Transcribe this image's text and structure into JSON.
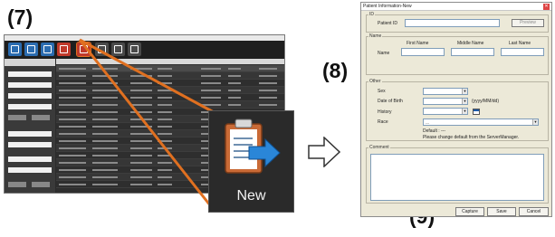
{
  "steps": {
    "seven": "(7)",
    "eight": "(8)",
    "nine": "(9)"
  },
  "toolbar": {
    "buttons": [
      {
        "icon": "list-icon",
        "color": "#2b6cb0"
      },
      {
        "icon": "edit-icon",
        "color": "#2b6cb0"
      },
      {
        "icon": "import-icon",
        "color": "#2b6cb0"
      },
      {
        "icon": "delete-icon",
        "color": "#c0392b"
      },
      {
        "icon": "new-patient-icon",
        "color": "#c0392b"
      },
      {
        "icon": "search-icon",
        "color": "#3a3a3a"
      },
      {
        "icon": "print-icon",
        "color": "#3a3a3a"
      },
      {
        "icon": "settings-icon",
        "color": "#3a3a3a"
      }
    ]
  },
  "zoom": {
    "label": "New",
    "icon": "new-patient-clipboard-icon"
  },
  "dialog": {
    "title": "Patient Information-New",
    "id_group": "ID",
    "patient_id_label": "Patient ID",
    "patient_id_value": "",
    "preview_button": "Preview",
    "name_group": "Name",
    "first_name_header": "First Name",
    "middle_name_header": "Middle Name",
    "last_name_header": "Last Name",
    "name_label": "Name",
    "other_group": "Other",
    "sex_label": "Sex",
    "dob_label": "Date of Birth",
    "dob_format": "(yyyy/MM/dd)",
    "history_label": "History",
    "race_label": "Race",
    "race_value": "---",
    "default_text": "Default : ---",
    "hint_text": "Please change default from the ServerManager.",
    "comment_group": "Comment",
    "capture_button": "Capture",
    "save_button": "Save",
    "cancel_button": "Cancel"
  },
  "colors": {
    "accent_orange": "#e07020",
    "dialog_bg": "#ece9d8",
    "app_dark": "#2b2b2b"
  }
}
